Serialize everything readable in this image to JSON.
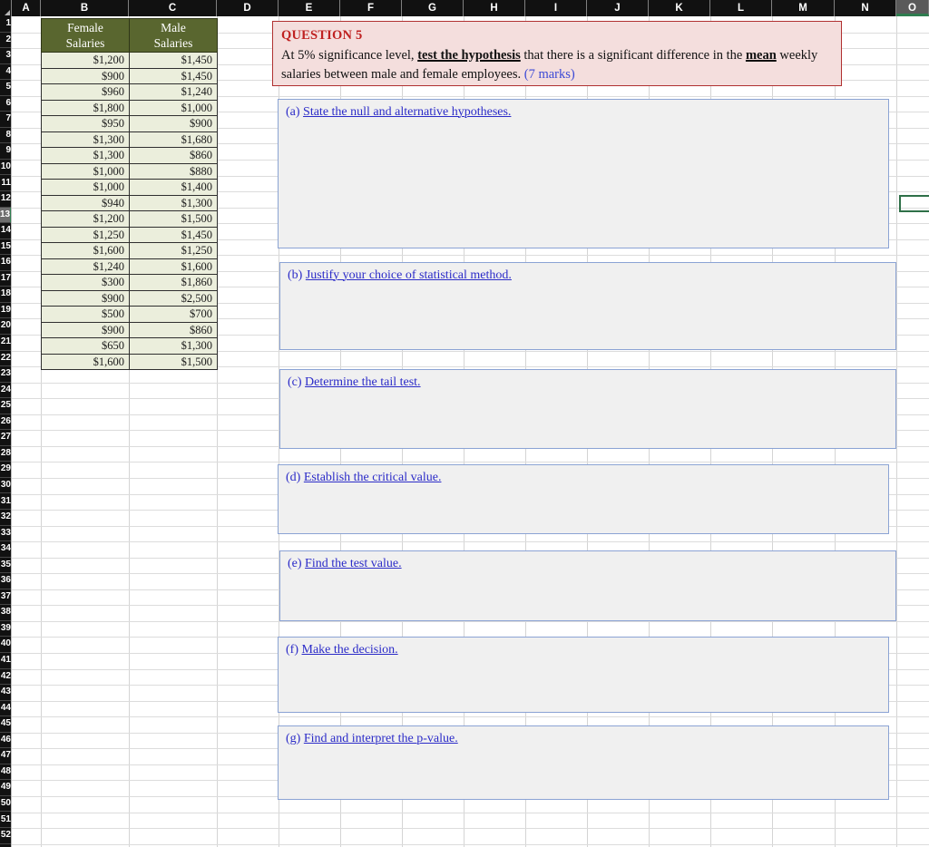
{
  "app": {
    "type": "spreadsheet"
  },
  "columns": {
    "labels": [
      "A",
      "B",
      "C",
      "D",
      "E",
      "F",
      "G",
      "H",
      "I",
      "J",
      "K",
      "L",
      "M",
      "N",
      "O"
    ],
    "selected": "O"
  },
  "rows": {
    "visible_partial_numbers": [
      "1",
      "2",
      "3",
      "4",
      "5",
      "6",
      "7",
      "8",
      "9",
      "10",
      "11",
      "12",
      "13",
      "14",
      "15",
      "16",
      "17",
      "18",
      "19",
      "20",
      "21",
      "22",
      "23",
      "24",
      "25",
      "26",
      "27",
      "28",
      "29",
      "30",
      "31",
      "32",
      "33",
      "34",
      "35",
      "36",
      "37",
      "38",
      "39",
      "40",
      "41",
      "42",
      "43",
      "44",
      "45",
      "46",
      "47",
      "48",
      "49",
      "50",
      "51",
      "52"
    ],
    "selected_index": 12
  },
  "table": {
    "headers": [
      "Female Salaries",
      "Male Salaries"
    ],
    "header_female": "Female\nSalaries",
    "header_male": "Male\nSalaries",
    "rows": [
      [
        "$1,200",
        "$1,450"
      ],
      [
        "$900",
        "$1,450"
      ],
      [
        "$960",
        "$1,240"
      ],
      [
        "$1,800",
        "$1,000"
      ],
      [
        "$950",
        "$900"
      ],
      [
        "$1,300",
        "$1,680"
      ],
      [
        "$1,300",
        "$860"
      ],
      [
        "$1,000",
        "$880"
      ],
      [
        "$1,000",
        "$1,400"
      ],
      [
        "$940",
        "$1,300"
      ],
      [
        "$1,200",
        "$1,500"
      ],
      [
        "$1,250",
        "$1,450"
      ],
      [
        "$1,600",
        "$1,250"
      ],
      [
        "$1,240",
        "$1,600"
      ],
      [
        "$300",
        "$1,860"
      ],
      [
        "$900",
        "$2,500"
      ],
      [
        "$500",
        "$700"
      ],
      [
        "$900",
        "$860"
      ],
      [
        "$650",
        "$1,300"
      ],
      [
        "$1,600",
        "$1,500"
      ]
    ]
  },
  "question": {
    "title": "QUESTION 5",
    "line1_pre": "At 5% significance level, ",
    "line1_underlined": "test the hypothesis",
    "line1_post": " that there is a significant difference in the ",
    "line2_underlined": "mean",
    "line2_post": " weekly salaries between male and female employees. ",
    "marks": "(7 marks)"
  },
  "subquestions": [
    {
      "id": "a",
      "tag": "(a) ",
      "text": "State the null and alternative hypotheses."
    },
    {
      "id": "b",
      "tag": "(b) ",
      "text": "Justify your choice of statistical method."
    },
    {
      "id": "c",
      "tag": "(c) ",
      "text": "Determine the tail test."
    },
    {
      "id": "d",
      "tag": "(d) ",
      "text": "Establish the critical value."
    },
    {
      "id": "e",
      "tag": "(e) ",
      "text": "Find the test value."
    },
    {
      "id": "f",
      "tag": "(f) ",
      "text": "Make the decision."
    },
    {
      "id": "g",
      "tag": "(g) ",
      "text": "Find and interpret the p-value."
    }
  ],
  "colors": {
    "table_header_bg": "#59662f",
    "table_cell_bg": "#ebeedc",
    "question_bg": "#f4dedd",
    "question_border": "#b03030",
    "question_title": "#bf2121",
    "marks_color": "#3b49d6",
    "subbox_bg": "#f0f0f0",
    "subbox_border": "#8ba3d4",
    "sub_text": "#2b2bc8",
    "active_cell_border": "#2f7048"
  }
}
